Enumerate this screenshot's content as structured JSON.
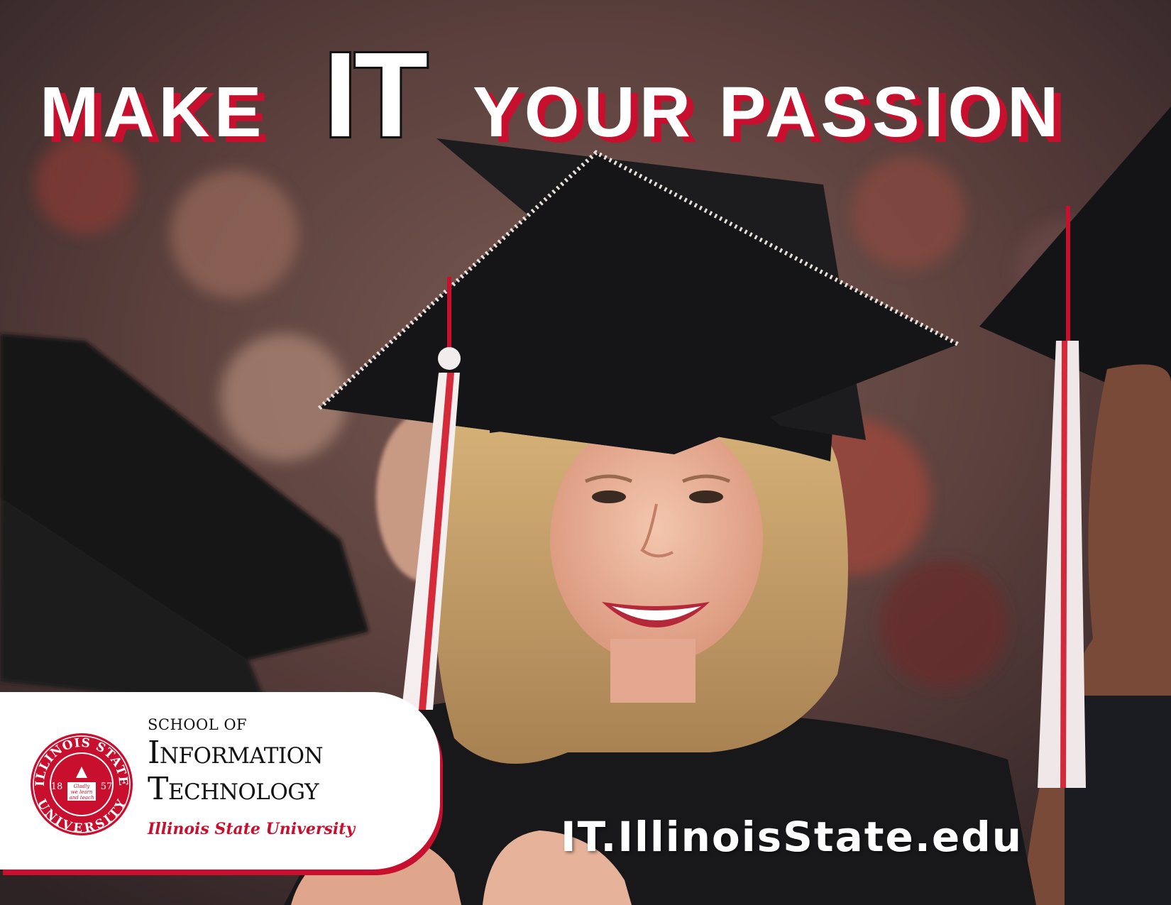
{
  "headline": {
    "word_1": "MAKE",
    "word_2": "IT",
    "word_3": "YOUR PASSION"
  },
  "logo": {
    "school_line": "SCHOOL OF",
    "line_1": "Information",
    "line_2": "Technology",
    "university": "Illinois State University",
    "seal_top": "ILLINOIS STATE",
    "seal_bottom": "UNIVERSITY",
    "seal_left_year": "18",
    "seal_right_year": "57",
    "seal_motto_1": "Gladly",
    "seal_motto_2": "we learn",
    "seal_motto_3": "and teach"
  },
  "url": "IT.IllinoisState.edu",
  "colors": {
    "brand_red": "#c8102e",
    "white": "#ffffff",
    "cap_black": "#151517"
  }
}
